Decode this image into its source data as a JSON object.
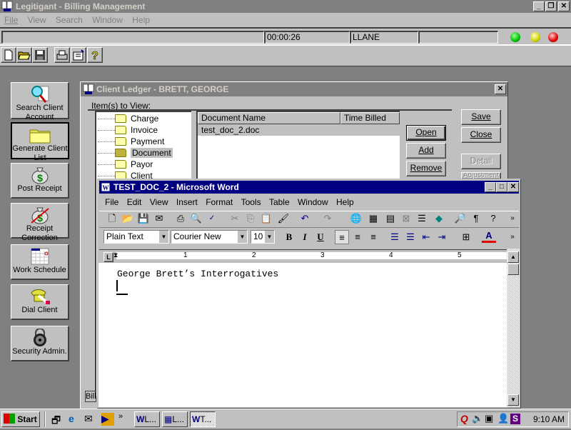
{
  "app": {
    "title": "Legitigant - Billing Management",
    "menu": [
      "File",
      "View",
      "Search",
      "Window",
      "Help"
    ],
    "status": {
      "timer": "00:00:26",
      "user": "LLANE",
      "field1": "",
      "field4": ""
    },
    "status_lights": [
      "#00e000",
      "#e0e000",
      "#e00000"
    ],
    "toolbar_icons": [
      "new-icon",
      "open-icon",
      "save-icon",
      "print-icon",
      "properties-icon",
      "help-icon"
    ]
  },
  "sidebar": {
    "buttons": [
      {
        "label": "Search Client Account",
        "icon": "search-icon"
      },
      {
        "label": "Generate Client List",
        "icon": "folder-icon"
      },
      {
        "label": "Post Receipt",
        "icon": "money-bag-icon"
      },
      {
        "label": "Receipt Correction",
        "icon": "money-bag-crossed-icon"
      },
      {
        "label": "Work Schedule",
        "icon": "calendar-icon"
      },
      {
        "label": "Dial Client",
        "icon": "phone-icon"
      },
      {
        "label": "Security Admin.",
        "icon": "padlock-icon"
      }
    ]
  },
  "ledger": {
    "title": "Client Ledger - BRETT, GEORGE",
    "items_label": "Item(s) to View:",
    "tree": [
      "Charge",
      "Invoice",
      "Payment",
      "Document",
      "Payor",
      "Client"
    ],
    "selected_tree": "Document",
    "columns": [
      "Document Name",
      "Time Billed"
    ],
    "rows": [
      {
        "name": "test_doc_2.doc",
        "time": ""
      }
    ],
    "buttons": {
      "open": "Open",
      "add": "Add",
      "remove": "Remove",
      "save": "Save",
      "close": "Close",
      "detail": "Detail",
      "adjustment": "Adjustment"
    },
    "bottom_tab": "Bill"
  },
  "word": {
    "title": "TEST_DOC_2 - Microsoft Word",
    "menu": [
      "File",
      "Edit",
      "View",
      "Insert",
      "Format",
      "Tools",
      "Table",
      "Window",
      "Help"
    ],
    "style": "Plain Text",
    "font": "Courier New",
    "size": "10",
    "ruler_labels": [
      "1",
      "2",
      "3",
      "4",
      "5"
    ],
    "content": "George Brett’s Interrogatives",
    "font_color": "#e00000"
  },
  "taskbar": {
    "start": "Start",
    "tasks": [
      "L...",
      "L...",
      "T..."
    ],
    "clock": "9:10 AM"
  }
}
